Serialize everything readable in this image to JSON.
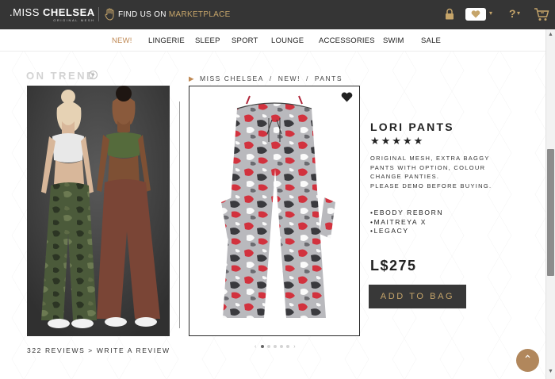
{
  "topbar": {
    "logo_prefix": ".MISS",
    "logo_name": "CHELSEA",
    "logo_sub": "ORIGINAL MESH",
    "find_text": "FIND US ON",
    "marketplace": "MARKETPLACE",
    "help_label": "?",
    "icons": [
      "hand-icon",
      "lock-icon",
      "heart-icon",
      "chevron-down-icon",
      "help-icon",
      "cart-icon"
    ]
  },
  "nav": {
    "items": [
      "NEW!",
      "LINGERIE",
      "SLEEP",
      "SPORT",
      "LOUNGE",
      "ACCESSORIES",
      "SWIM",
      "SALE"
    ],
    "active": "NEW!"
  },
  "on_trend": {
    "label": "ON TREND",
    "reviews": "322 REVIEWS  >  WRITE A REVIEW"
  },
  "breadcrumb": [
    "MISS CHELSEA",
    "NEW!",
    "PANTS"
  ],
  "product": {
    "title": "LORI PANTS",
    "rating": 5,
    "stars": "★★★★★",
    "description": [
      "ORIGINAL MESH, EXTRA BAGGY",
      "PANTS WITH OPTION, COLOUR",
      "CHANGE PANTIES.",
      "PLEASE DEMO BEFORE BUYING."
    ],
    "compatibility": [
      "•EBODY REBORN",
      "•MAITREYA X",
      "•LEGACY"
    ],
    "price": "L$275",
    "add_to_bag": "ADD TO BAG"
  },
  "gallery": {
    "slides": 5,
    "current": 1
  },
  "colors": {
    "topbar": "#353535",
    "gold": "#c6a56a",
    "accent_nav": "#c08a55",
    "button_dark": "#383838",
    "camo_red": "#d2323e"
  }
}
